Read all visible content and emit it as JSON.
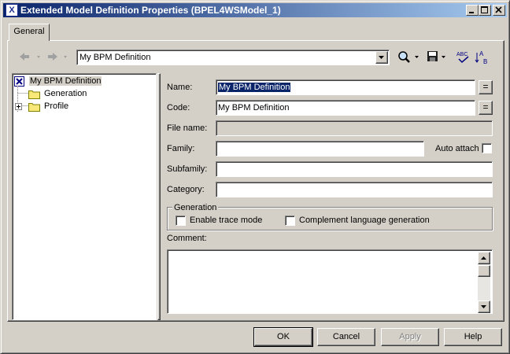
{
  "window": {
    "title": "Extended Model Definition Properties  (BPEL4WSModel_1)",
    "app_icon": "X"
  },
  "tabs": [
    {
      "label": "General"
    }
  ],
  "toolbar": {
    "combo_value": "My BPM Definition"
  },
  "tree": {
    "root": "My BPM Definition",
    "children": [
      {
        "label": "Generation"
      },
      {
        "label": "Profile",
        "expander": "+"
      }
    ]
  },
  "form": {
    "name_label": "Name:",
    "name_value": "My BPM Definition",
    "code_label": "Code:",
    "code_value": "My BPM Definition",
    "filename_label": "File name:",
    "filename_value": "",
    "family_label": "Family:",
    "family_value": "",
    "auto_attach_label": "Auto attach",
    "subfamily_label": "Subfamily:",
    "subfamily_value": "",
    "category_label": "Category:",
    "category_value": "",
    "generation_group_label": "Generation",
    "enable_trace_label": "Enable trace mode",
    "complement_label": "Complement language generation",
    "comment_label": "Comment:",
    "comment_value": "",
    "eq_button": "="
  },
  "buttons": {
    "ok": "OK",
    "cancel": "Cancel",
    "apply": "Apply",
    "help": "Help"
  },
  "colors": {
    "title_bar_start": "#0a246a",
    "title_bar_end": "#a6caf0",
    "face": "#d4d0c8",
    "selection": "#0a246a"
  }
}
